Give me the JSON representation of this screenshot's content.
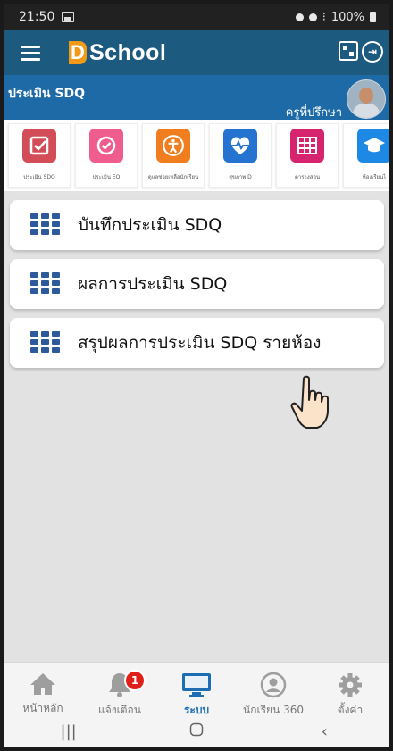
{
  "status_bar": {
    "time": "21:50",
    "battery": "100%"
  },
  "app": {
    "logo_letter": "D",
    "logo_text": "School"
  },
  "header": {
    "title": "ประเมิน SDQ",
    "role": "ครูที่ปรึกษา"
  },
  "quick_menu": [
    {
      "label": "ประเมิน SDQ",
      "color": "#d24d57",
      "icon": "check-square-icon"
    },
    {
      "label": "ประเมิน EQ",
      "color": "#ef5d8e",
      "icon": "check-circle-icon"
    },
    {
      "label": "ดูแลช่วยเหลือนักเรียน",
      "color": "#f07d1e",
      "icon": "accessibility-icon"
    },
    {
      "label": "สุขภาพ D",
      "color": "#2473d0",
      "icon": "heart-pulse-icon"
    },
    {
      "label": "ตารางสอน",
      "color": "#d6246e",
      "icon": "table-icon"
    },
    {
      "label": "ห้องเรียนไ",
      "color": "#1e88e5",
      "icon": "graduation-cap-icon"
    }
  ],
  "menu_items": [
    {
      "label": "บันทึกประเมิน SDQ"
    },
    {
      "label": "ผลการประเมิน SDQ"
    },
    {
      "label": "สรุปผลการประเมิน SDQ รายห้อง"
    }
  ],
  "bottom_nav": [
    {
      "label": "หน้าหลัก",
      "icon": "home-icon"
    },
    {
      "label": "แจ้งเตือน",
      "icon": "bell-icon",
      "badge": "1"
    },
    {
      "label": "ระบบ",
      "icon": "monitor-icon",
      "active": true
    },
    {
      "label": "นักเรียน 360",
      "icon": "user-circle-icon"
    },
    {
      "label": "ตั้งค่า",
      "icon": "gear-icon"
    }
  ],
  "colors": {
    "app_bar": "#1d5a80",
    "title_strip": "#1e6aa6",
    "accent": "#1d6db5"
  }
}
